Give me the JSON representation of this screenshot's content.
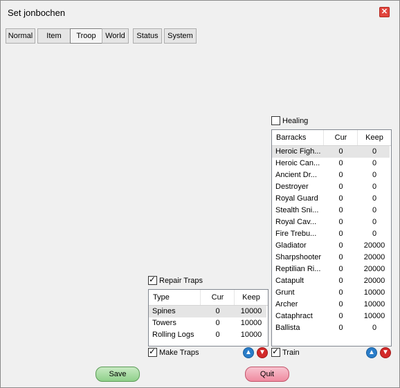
{
  "window": {
    "title": "Set jonbochen"
  },
  "tabs": [
    "Normal",
    "Item",
    "Troop",
    "World",
    "Status",
    "System"
  ],
  "healing": {
    "label": "Healing",
    "checked": false
  },
  "barracks": {
    "headers": [
      "Barracks",
      "Cur",
      "Keep"
    ],
    "rows": [
      [
        "Heroic Figh...",
        "0",
        "0"
      ],
      [
        "Heroic Can...",
        "0",
        "0"
      ],
      [
        "Ancient Dr...",
        "0",
        "0"
      ],
      [
        "Destroyer",
        "0",
        "0"
      ],
      [
        "Royal Guard",
        "0",
        "0"
      ],
      [
        "Stealth Sni...",
        "0",
        "0"
      ],
      [
        "Royal Cav...",
        "0",
        "0"
      ],
      [
        "Fire Trebu...",
        "0",
        "0"
      ],
      [
        "Gladiator",
        "0",
        "20000"
      ],
      [
        "Sharpshooter",
        "0",
        "20000"
      ],
      [
        "Reptilian Ri...",
        "0",
        "20000"
      ],
      [
        "Catapult",
        "0",
        "20000"
      ],
      [
        "Grunt",
        "0",
        "10000"
      ],
      [
        "Archer",
        "0",
        "10000"
      ],
      [
        "Cataphract",
        "0",
        "10000"
      ],
      [
        "Ballista",
        "0",
        "0"
      ]
    ]
  },
  "train": {
    "label": "Train",
    "checked": true
  },
  "repair_traps": {
    "label": "Repair Traps",
    "checked": true
  },
  "traps": {
    "headers": [
      "Type",
      "Cur",
      "Keep"
    ],
    "rows": [
      [
        "Spines",
        "0",
        "10000"
      ],
      [
        "Towers",
        "0",
        "10000"
      ],
      [
        "Rolling Logs",
        "0",
        "10000"
      ]
    ]
  },
  "make_traps": {
    "label": "Make Traps",
    "checked": true
  },
  "buttons": {
    "save": "Save",
    "quit": "Quit"
  },
  "icons": {
    "close": "close-icon",
    "up": "arrow-up-icon",
    "down": "arrow-down-icon",
    "check": "checkmark-icon"
  },
  "colors": {
    "up_arrow": "#2a7dc9",
    "down_arrow": "#d32a2a",
    "save_button": "#8fd08a",
    "quit_button": "#ef8ba0",
    "close_button": "#e1463e"
  }
}
